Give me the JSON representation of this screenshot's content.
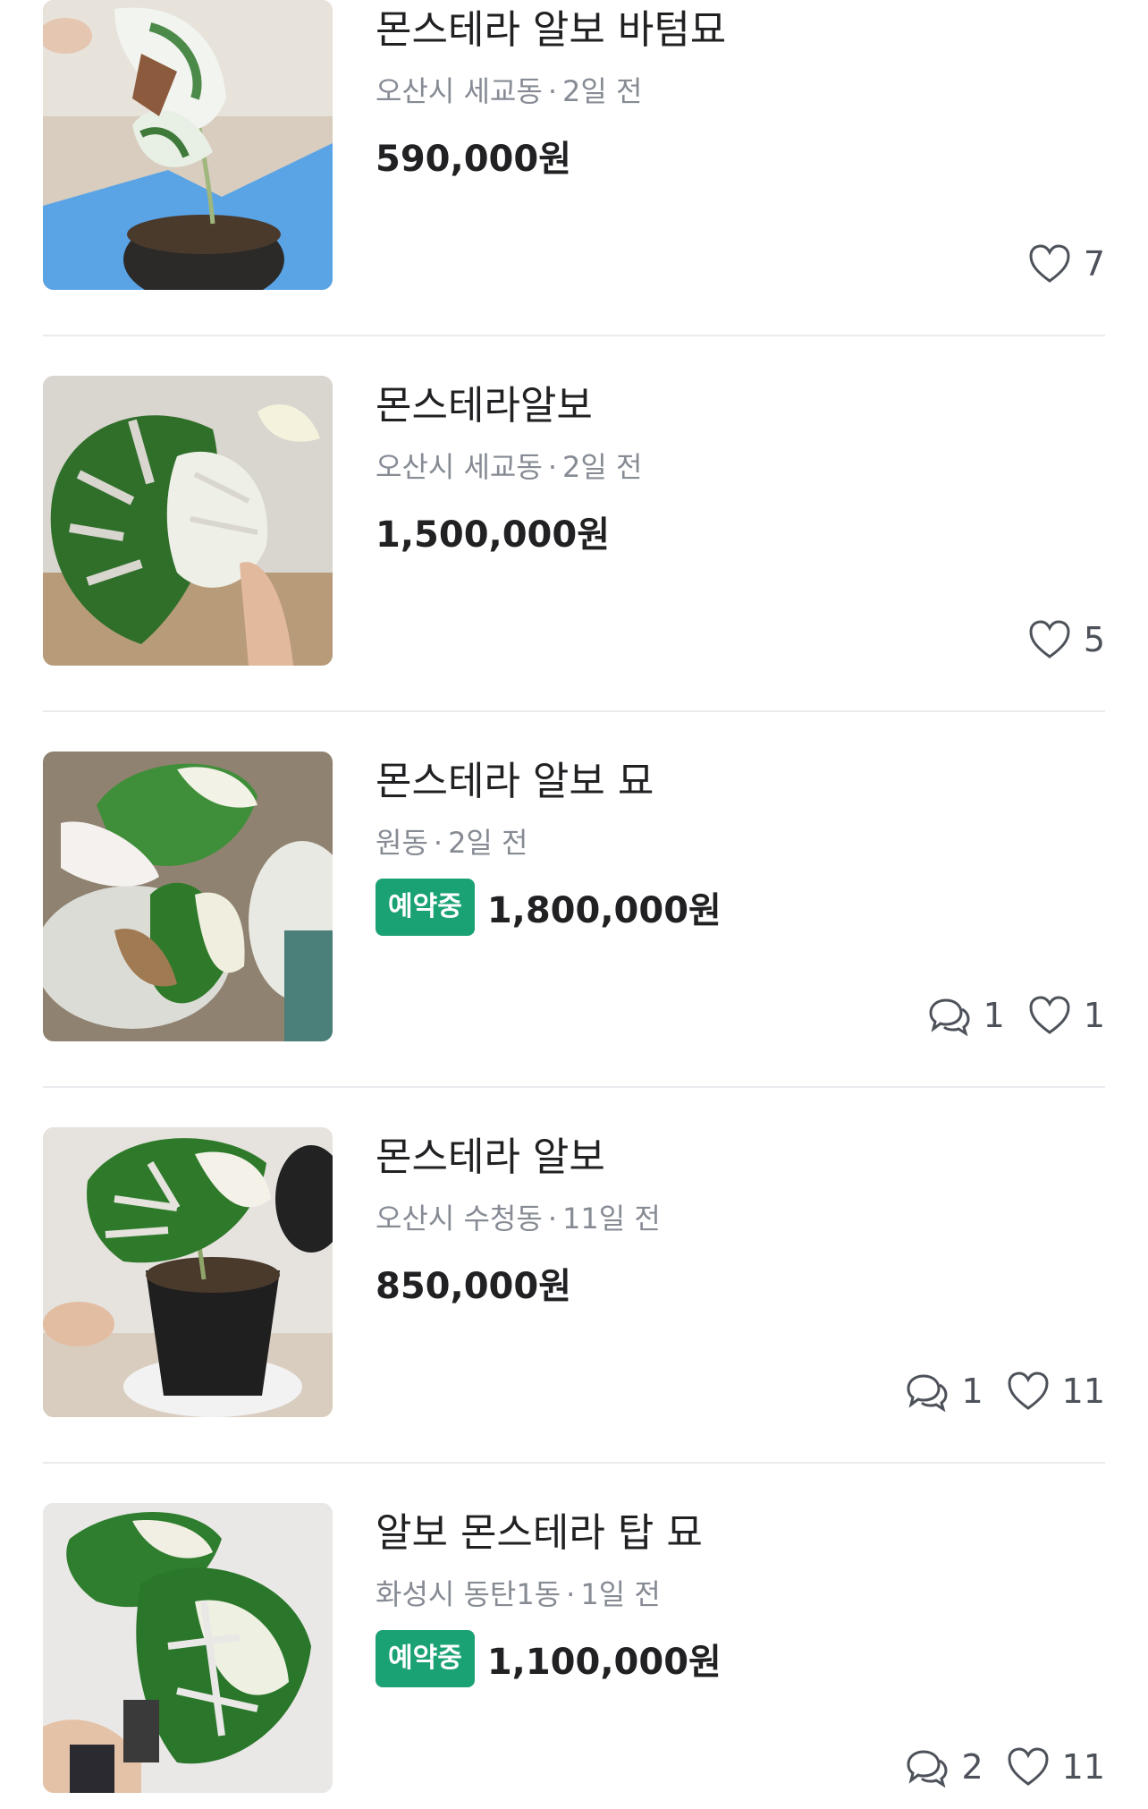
{
  "listings": [
    {
      "title": "몬스테라 알보 바텀묘",
      "location": "오산시 세교동",
      "time": "2일 전",
      "price": "590,000원",
      "badge": "",
      "chats": "",
      "likes": "7",
      "icons": {
        "chat": "chat-bubbles-icon",
        "like": "heart-icon"
      }
    },
    {
      "title": "몬스테라알보",
      "location": "오산시 세교동",
      "time": "2일 전",
      "price": "1,500,000원",
      "badge": "",
      "chats": "",
      "likes": "5"
    },
    {
      "title": "몬스테라 알보 묘",
      "location": "원동",
      "time": "2일 전",
      "price": "1,800,000원",
      "badge": "예약중",
      "chats": "1",
      "likes": "1"
    },
    {
      "title": "몬스테라 알보",
      "location": "오산시 수청동",
      "time": "11일 전",
      "price": "850,000원",
      "badge": "",
      "chats": "1",
      "likes": "11"
    },
    {
      "title": "알보 몬스테라 탑 묘",
      "location": "화성시 동탄1동",
      "time": "1일 전",
      "price": "1,100,000원",
      "badge": "예약중",
      "chats": "2",
      "likes": "11"
    }
  ],
  "separator": "·",
  "colors": {
    "badge": "#1aa174",
    "meta": "#868b94",
    "divider": "#eaebee"
  }
}
